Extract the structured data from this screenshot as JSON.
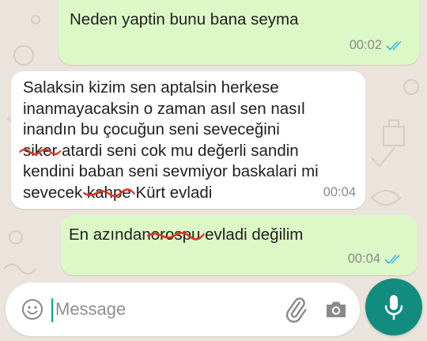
{
  "colors": {
    "wallpaper": "#ebe4dc",
    "outgoing_bubble": "#dcf8c6",
    "incoming_bubble": "#ffffff",
    "read_ticks": "#34b7f1",
    "scribble": "#e5321f",
    "mic_button": "#128c7e"
  },
  "messages": [
    {
      "direction": "outgoing",
      "text": "Neden yaptin bunu bana seyma",
      "time": "00:02",
      "status": "read"
    },
    {
      "direction": "incoming",
      "line1": "Salaksin kizim sen aptalsin herkese",
      "line2": "inanmayacaksin o zaman asıl sen nasıl",
      "line3": "inandın bu çocuğun seni seveceğini",
      "line4_redacted": "siker",
      "line4_rest": " atardi seni cok mu değerli sandin",
      "line5": "kendini baban seni sevmiyor baskalari mi",
      "line6_start": "sevecek ",
      "line6_redacted": "kahpe",
      "line6_end": " Kürt evladi",
      "time": "00:04"
    },
    {
      "direction": "outgoing",
      "text_start": "En azından",
      "text_redacted": "orospu",
      "text_end": " evladi değilim",
      "time": "00:04",
      "status": "read"
    }
  ],
  "composer": {
    "placeholder": "Message",
    "emoji_icon": "emoji-icon",
    "attach_icon": "paperclip-icon",
    "camera_icon": "camera-icon",
    "mic_icon": "microphone-icon"
  }
}
